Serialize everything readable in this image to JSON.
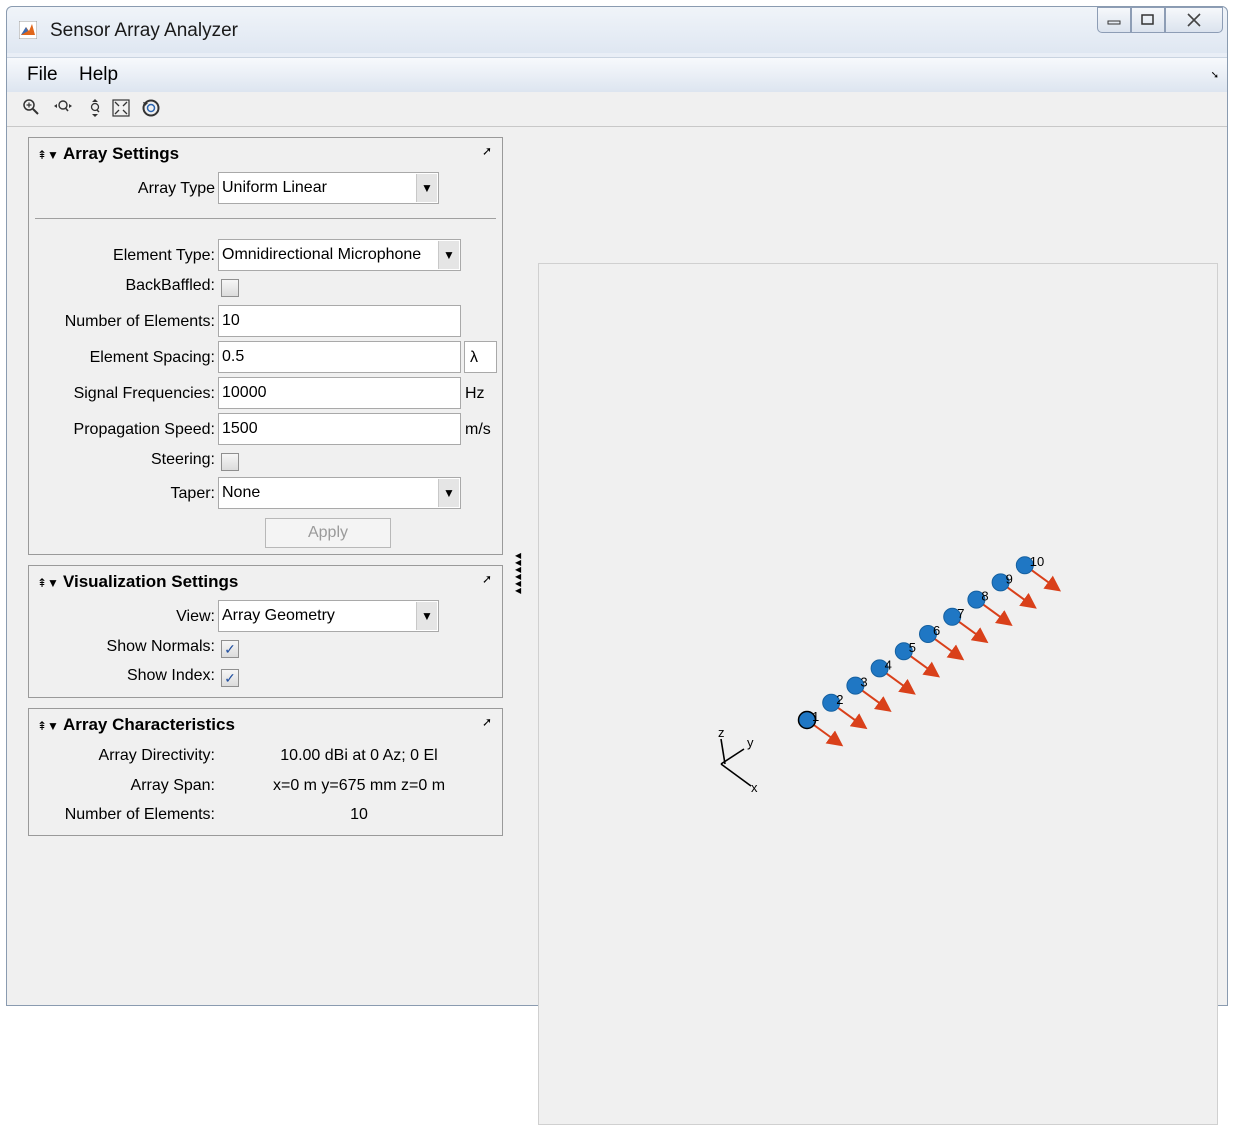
{
  "window": {
    "title": "Sensor Array Analyzer"
  },
  "menu": {
    "file": "File",
    "help": "Help"
  },
  "toolbar": {
    "icons": [
      "zoom-in-icon",
      "zoom-out-icon",
      "pan-icon",
      "fit-to-window-icon",
      "rotate-icon"
    ]
  },
  "array_settings": {
    "header": "Array Settings",
    "array_type_label": "Array Type",
    "array_type_value": "Uniform Linear",
    "element_type_label": "Element Type:",
    "element_type_value": "Omnidirectional Microphone",
    "backbaffled_label": "BackBaffled:",
    "backbaffled_checked": false,
    "num_elements_label": "Number of Elements:",
    "num_elements_value": "10",
    "element_spacing_label": "Element Spacing:",
    "element_spacing_value": "0.5",
    "element_spacing_unit": "λ",
    "signal_freq_label": "Signal Frequencies:",
    "signal_freq_value": "10000",
    "signal_freq_unit": "Hz",
    "prop_speed_label": "Propagation Speed:",
    "prop_speed_value": "1500",
    "prop_speed_unit": "m/s",
    "steering_label": "Steering:",
    "steering_checked": false,
    "taper_label": "Taper:",
    "taper_value": "None",
    "apply_label": "Apply"
  },
  "visualization_settings": {
    "header": "Visualization Settings",
    "view_label": "View:",
    "view_value": "Array Geometry",
    "show_normals_label": "Show Normals:",
    "show_normals_checked": true,
    "show_index_label": "Show Index:",
    "show_index_checked": true
  },
  "array_characteristics": {
    "header": "Array Characteristics",
    "directivity_label": "Array Directivity:",
    "directivity_value": "10.00 dBi at 0 Az; 0 El",
    "span_label": "Array Span:",
    "span_value": "x=0 m y=675 mm z=0 m",
    "num_elements_label": "Number of Elements:",
    "num_elements_value": "10"
  },
  "plot": {
    "element_indices": [
      "1",
      "2",
      "3",
      "4",
      "5",
      "6",
      "7",
      "8",
      "9",
      "10"
    ],
    "axis_labels": {
      "x": "x",
      "y": "y",
      "z": "z"
    },
    "element_color": "#1f77c4",
    "normal_color": "#d9401a"
  }
}
